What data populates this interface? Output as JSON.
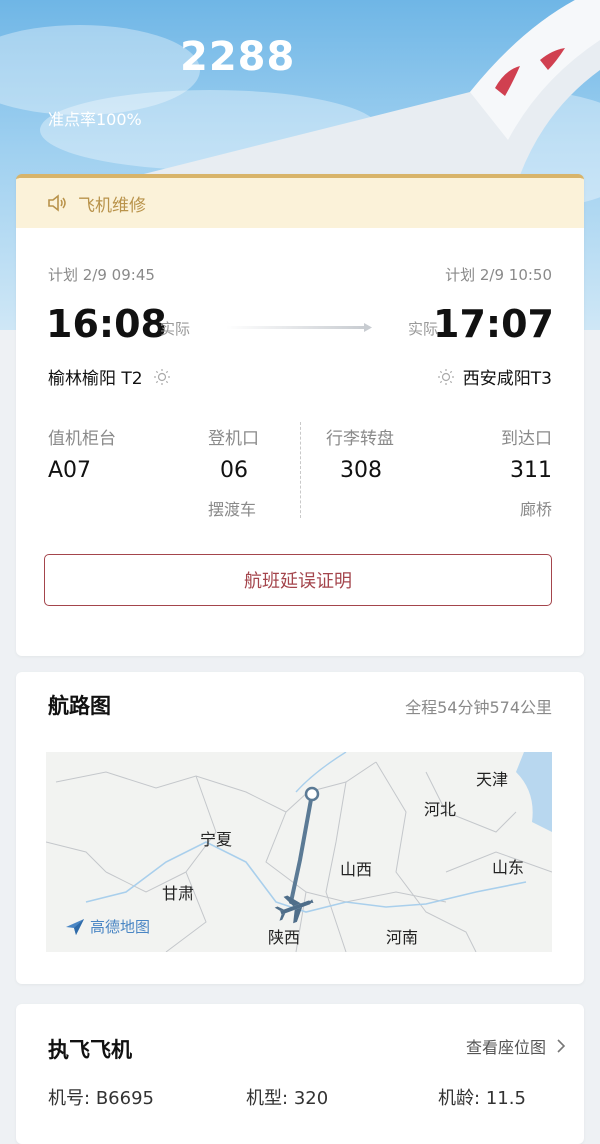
{
  "header": {
    "flight_number": "2288",
    "on_time_rate": "准点率100%"
  },
  "notice": {
    "icon": "speaker-icon",
    "text": "飞机维修"
  },
  "departure": {
    "plan": "计划 2/9 09:45",
    "actual_time": "16:08",
    "actual_label": "实际",
    "airport": "榆林榆阳 T2"
  },
  "arrival": {
    "plan": "计划 2/9 10:50",
    "actual_time": "17:07",
    "actual_label": "实际",
    "airport": "西安咸阳T3"
  },
  "info": {
    "checkin_label": "值机柜台",
    "checkin_value": "A07",
    "gate_label": "登机口",
    "gate_value": "06",
    "gate_sub": "摆渡车",
    "baggage_label": "行李转盘",
    "baggage_value": "308",
    "exit_label": "到达口",
    "exit_value": "311",
    "exit_sub": "廊桥"
  },
  "delay_button": "航班延误证明",
  "route": {
    "title": "航路图",
    "summary": "全程54分钟574公里",
    "map_labels": [
      "天津",
      "河北",
      "宁夏",
      "山西",
      "山东",
      "甘肃",
      "陕西",
      "河南"
    ],
    "map_logo": "高德地图"
  },
  "aircraft": {
    "title": "执飞飞机",
    "seat_map": "查看座位图",
    "reg_label": "机号:",
    "reg_value": "B6695",
    "type_label": "机型:",
    "type_value": "320",
    "age_label": "机龄:",
    "age_value": "11.5"
  },
  "colors": {
    "accent": "#a4454c",
    "notice_bg": "#fbf2d9",
    "notice_text": "#b9934b",
    "route_line": "#5b7a95"
  }
}
